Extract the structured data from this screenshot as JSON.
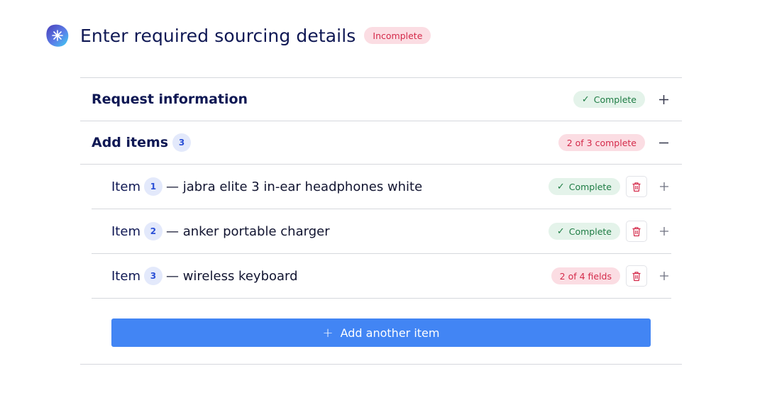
{
  "header": {
    "logo_icon": "sparkle-logo-icon",
    "title": "Enter required sourcing details",
    "status": "Incomplete"
  },
  "sections": {
    "request": {
      "title": "Request information",
      "status": "Complete",
      "toggle_icon": "plus-icon"
    },
    "items": {
      "title": "Add items",
      "count": "3",
      "status": "2 of 3 complete",
      "toggle_icon": "minus-icon",
      "rows": [
        {
          "label": "Item",
          "number": "1",
          "name": "— jabra elite 3 in-ear headphones white",
          "status": "Complete",
          "state": "complete"
        },
        {
          "label": "Item",
          "number": "2",
          "name": "— anker portable charger",
          "status": "Complete",
          "state": "complete"
        },
        {
          "label": "Item",
          "number": "3",
          "name": "— wireless keyboard",
          "status": "2 of 4 fields",
          "state": "incomplete"
        }
      ],
      "add_button": "Add another item"
    }
  },
  "colors": {
    "title_navy": "#0f1854",
    "accent_blue": "#4285f4",
    "complete_bg": "#e4f3ea",
    "complete_text": "#1e7c44",
    "incomplete_bg": "#fbdde3",
    "incomplete_text": "#d42a4a"
  }
}
